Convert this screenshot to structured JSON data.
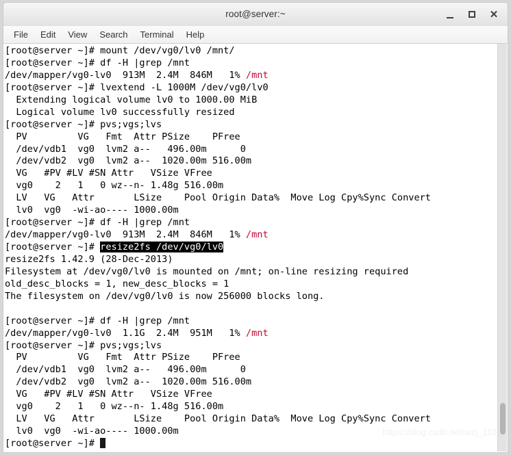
{
  "window": {
    "title": "root@server:~",
    "controls": {
      "minimize": "minimize-icon",
      "maximize": "maximize-icon",
      "close": "close-icon"
    }
  },
  "menubar": {
    "items": [
      {
        "label": "File"
      },
      {
        "label": "Edit"
      },
      {
        "label": "View"
      },
      {
        "label": "Search"
      },
      {
        "label": "Terminal"
      },
      {
        "label": "Help"
      }
    ]
  },
  "terminal": {
    "prompt": "[root@server ~]# ",
    "selection_text": "resize2fs /dev/vg0/lv0",
    "mount_point": "/mnt",
    "colors": {
      "background": "#ffffff",
      "foreground": "#000000",
      "highlight_bg": "#000000",
      "highlight_fg": "#ffffff",
      "mount_red": "#cc0033"
    },
    "lines": [
      {
        "type": "prompt",
        "text": "mount /dev/vg0/lv0 /mnt/"
      },
      {
        "type": "prompt",
        "text": "df -H |grep /mnt"
      },
      {
        "type": "df",
        "pre": "/dev/mapper/vg0-lv0  913M  2.4M  846M   1% ",
        "red": "/mnt"
      },
      {
        "type": "prompt",
        "text": "lvextend -L 1000M /dev/vg0/lv0"
      },
      {
        "type": "out",
        "text": "  Extending logical volume lv0 to 1000.00 MiB"
      },
      {
        "type": "out",
        "text": "  Logical volume lv0 successfully resized"
      },
      {
        "type": "prompt",
        "text": "pvs;vgs;lvs"
      },
      {
        "type": "out",
        "text": "  PV         VG   Fmt  Attr PSize    PFree"
      },
      {
        "type": "out",
        "text": "  /dev/vdb1  vg0  lvm2 a--   496.00m      0"
      },
      {
        "type": "out",
        "text": "  /dev/vdb2  vg0  lvm2 a--  1020.00m 516.00m"
      },
      {
        "type": "out",
        "text": "  VG   #PV #LV #SN Attr   VSize VFree"
      },
      {
        "type": "out",
        "text": "  vg0    2   1   0 wz--n- 1.48g 516.00m"
      },
      {
        "type": "out",
        "text": "  LV   VG   Attr       LSize    Pool Origin Data%  Move Log Cpy%Sync Convert"
      },
      {
        "type": "out",
        "text": "  lv0  vg0  -wi-ao---- 1000.00m"
      },
      {
        "type": "prompt",
        "text": "df -H |grep /mnt"
      },
      {
        "type": "df",
        "pre": "/dev/mapper/vg0-lv0  913M  2.4M  846M   1% ",
        "red": "/mnt"
      },
      {
        "type": "prompt-selected",
        "text": "resize2fs /dev/vg0/lv0"
      },
      {
        "type": "out",
        "text": "resize2fs 1.42.9 (28-Dec-2013)"
      },
      {
        "type": "out",
        "text": "Filesystem at /dev/vg0/lv0 is mounted on /mnt; on-line resizing required"
      },
      {
        "type": "out",
        "text": "old_desc_blocks = 1, new_desc_blocks = 1"
      },
      {
        "type": "out",
        "text": "The filesystem on /dev/vg0/lv0 is now 256000 blocks long."
      },
      {
        "type": "out",
        "text": ""
      },
      {
        "type": "prompt",
        "text": "df -H |grep /mnt"
      },
      {
        "type": "df",
        "pre": "/dev/mapper/vg0-lv0  1.1G  2.4M  951M   1% ",
        "red": "/mnt"
      },
      {
        "type": "prompt",
        "text": "pvs;vgs;lvs"
      },
      {
        "type": "out",
        "text": "  PV         VG   Fmt  Attr PSize    PFree"
      },
      {
        "type": "out",
        "text": "  /dev/vdb1  vg0  lvm2 a--   496.00m      0"
      },
      {
        "type": "out",
        "text": "  /dev/vdb2  vg0  lvm2 a--  1020.00m 516.00m"
      },
      {
        "type": "out",
        "text": "  VG   #PV #LV #SN Attr   VSize VFree"
      },
      {
        "type": "out",
        "text": "  vg0    2   1   0 wz--n- 1.48g 516.00m"
      },
      {
        "type": "out",
        "text": "  LV   VG   Attr       LSize    Pool Origin Data%  Move Log Cpy%Sync Convert"
      },
      {
        "type": "out",
        "text": "  lv0  vg0  -wi-ao---- 1000.00m"
      },
      {
        "type": "prompt-cursor",
        "text": ""
      }
    ]
  },
  "scrollbar": {
    "name": "vertical-scrollbar"
  },
  "watermark": {
    "text": "https://blog.csdn.net/wzj_110"
  }
}
